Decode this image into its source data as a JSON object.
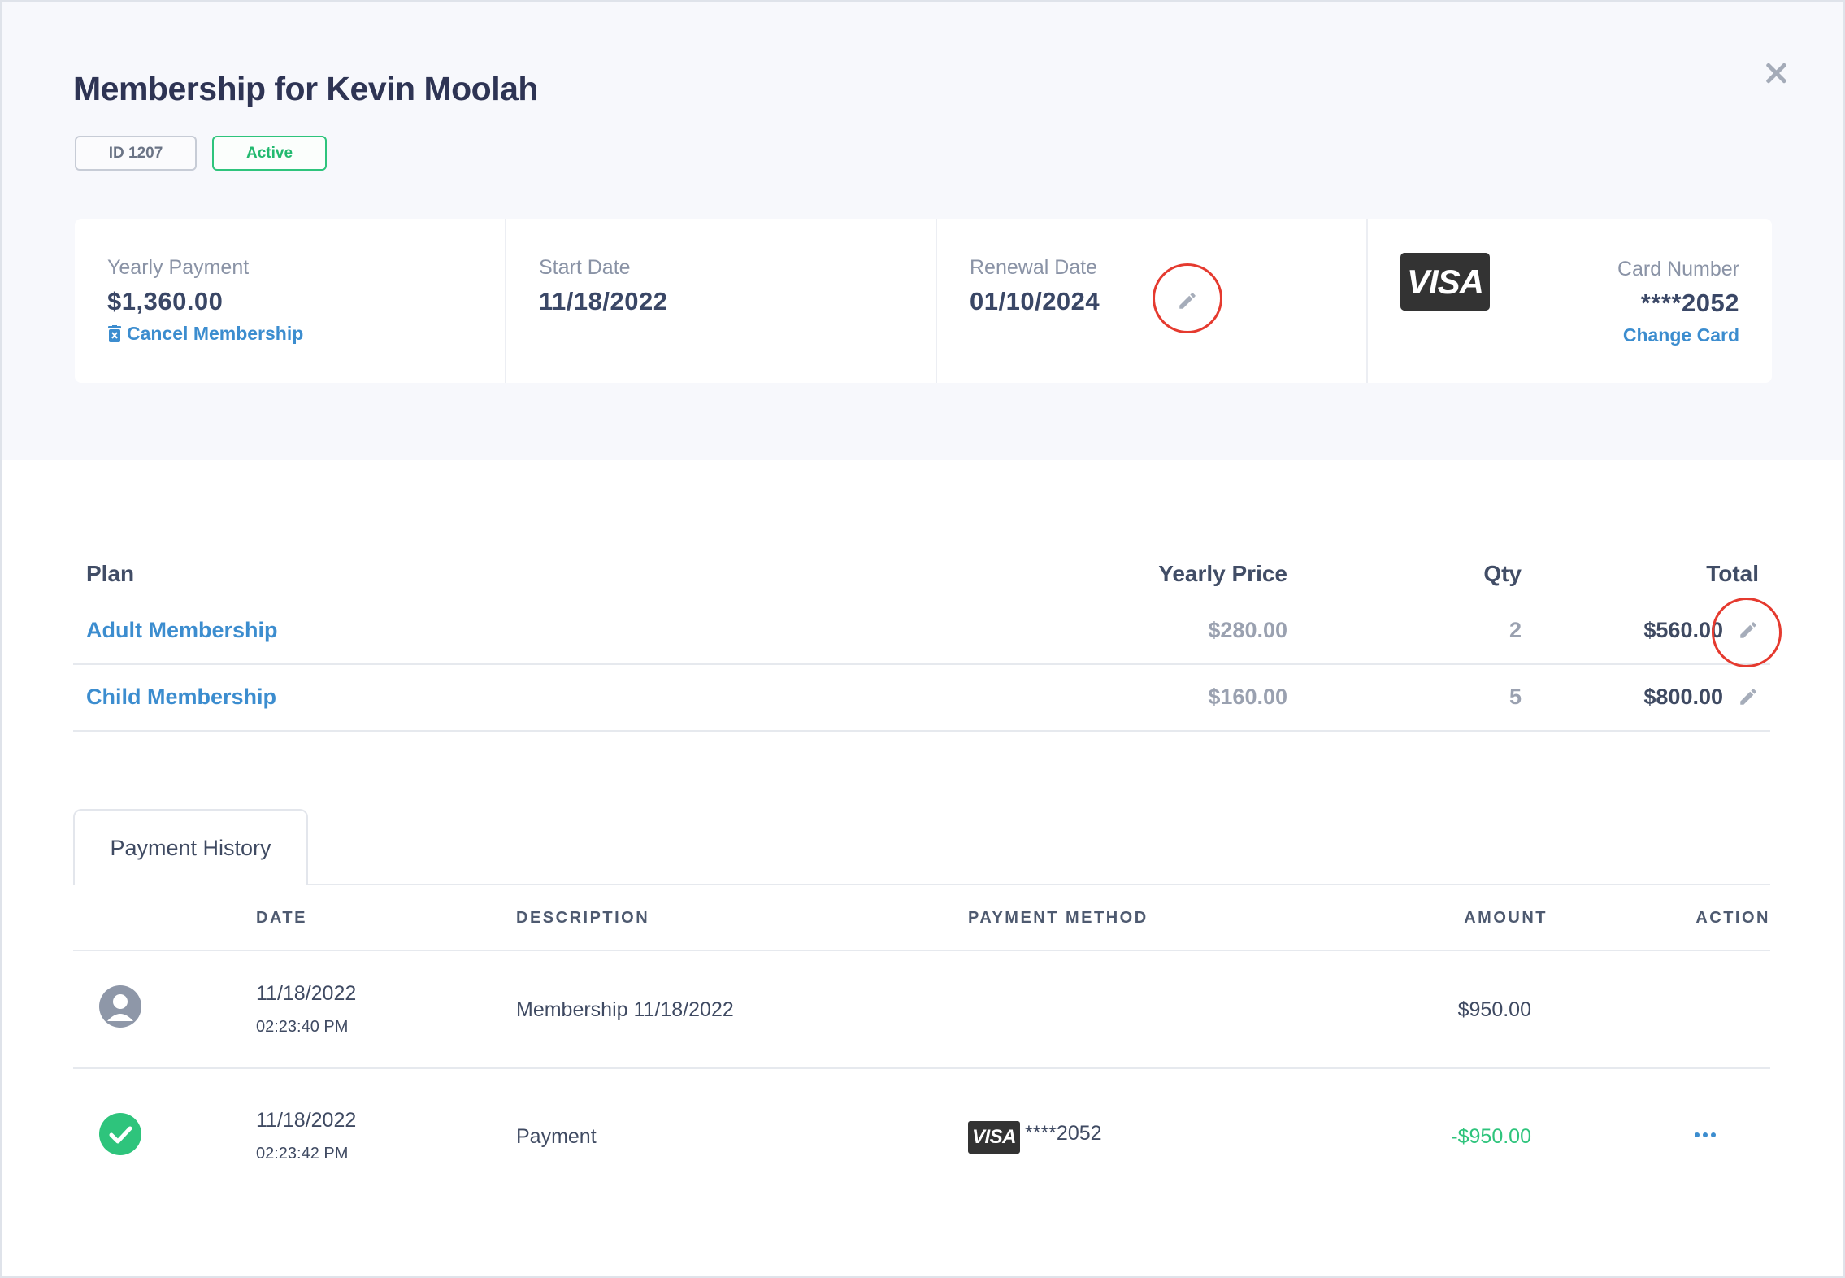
{
  "modal": {
    "title": "Membership for Kevin Moolah",
    "badges": {
      "id": "ID 1207",
      "status": "Active"
    }
  },
  "summary": {
    "yearly_payment": {
      "label": "Yearly Payment",
      "value": "$1,360.00",
      "cancel_label": "Cancel Membership"
    },
    "start_date": {
      "label": "Start Date",
      "value": "11/18/2022"
    },
    "renewal_date": {
      "label": "Renewal Date",
      "value": "01/10/2024"
    },
    "card": {
      "brand": "VISA",
      "label": "Card Number",
      "value": "****2052",
      "change_label": "Change Card"
    }
  },
  "plans": {
    "headers": {
      "plan": "Plan",
      "price": "Yearly Price",
      "qty": "Qty",
      "total": "Total"
    },
    "rows": [
      {
        "name": "Adult Membership",
        "price": "$280.00",
        "qty": "2",
        "total": "$560.00"
      },
      {
        "name": "Child Membership",
        "price": "$160.00",
        "qty": "5",
        "total": "$800.00"
      }
    ]
  },
  "tabs": {
    "payment_history": "Payment History"
  },
  "payment_history": {
    "headers": {
      "date": "DATE",
      "description": "DESCRIPTION",
      "method": "PAYMENT METHOD",
      "amount": "AMOUNT",
      "action": "ACTION"
    },
    "rows": [
      {
        "icon": "user-icon",
        "date": "11/18/2022",
        "time": "02:23:40 PM",
        "description": "Membership 11/18/2022",
        "method": "",
        "amount": "$950.00"
      },
      {
        "icon": "check-circle-icon",
        "date": "11/18/2022",
        "time": "02:23:42 PM",
        "description": "Payment",
        "method_brand": "VISA",
        "method": "****2052",
        "amount": "-$950.00"
      }
    ]
  },
  "colors": {
    "accent": "#3c8dcf",
    "success": "#2ec47c",
    "annotation": "#e53a2f",
    "title": "#2e3454"
  }
}
